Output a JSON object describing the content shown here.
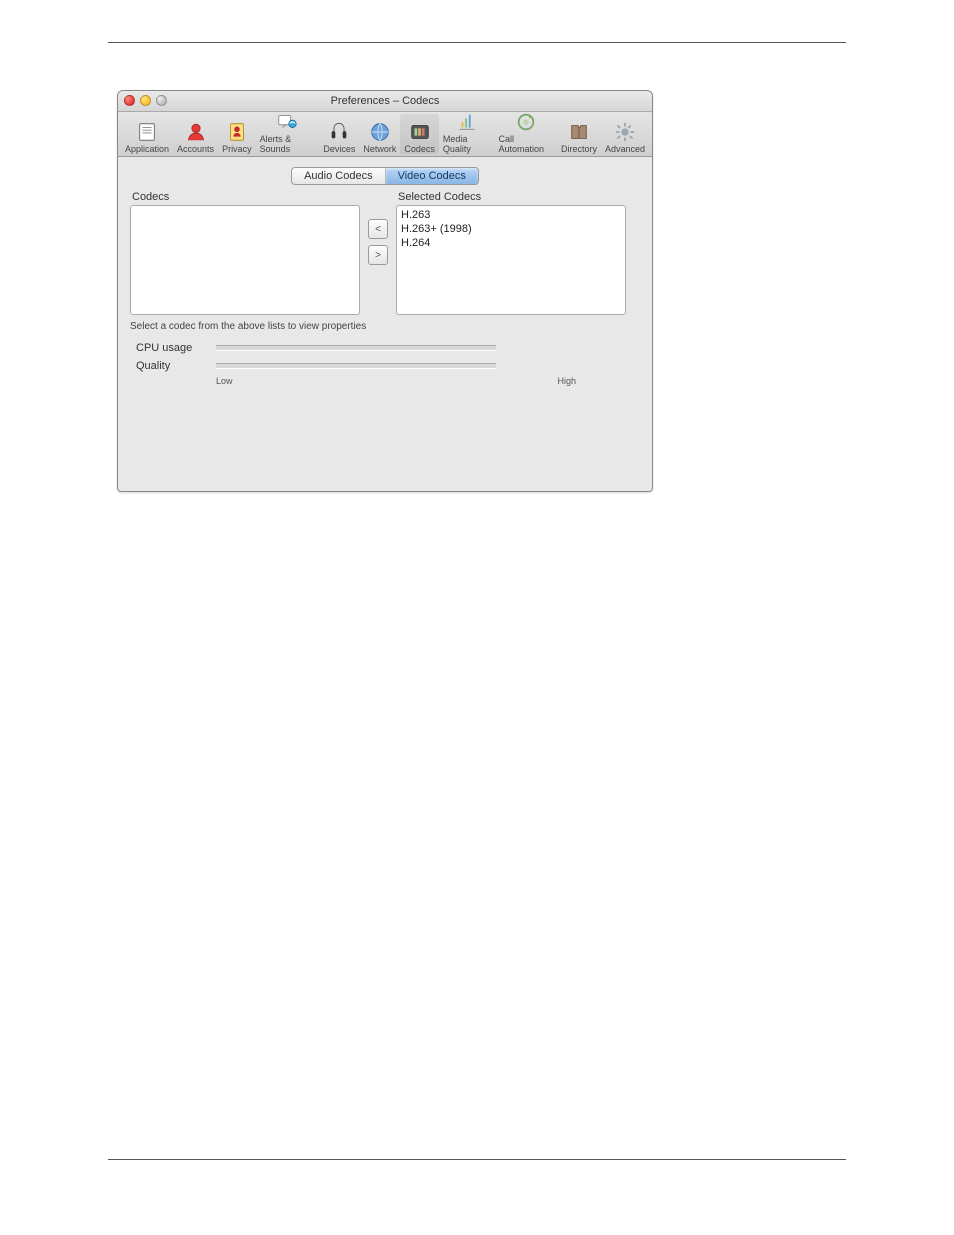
{
  "window": {
    "title": "Preferences – Codecs"
  },
  "toolbar": [
    {
      "label": "Application"
    },
    {
      "label": "Accounts"
    },
    {
      "label": "Privacy"
    },
    {
      "label": "Alerts & Sounds"
    },
    {
      "label": "Devices"
    },
    {
      "label": "Network"
    },
    {
      "label": "Codecs"
    },
    {
      "label": "Media Quality"
    },
    {
      "label": "Call Automation"
    },
    {
      "label": "Directory"
    },
    {
      "label": "Advanced"
    }
  ],
  "tabs": [
    "Audio Codecs",
    "Video Codecs"
  ],
  "lists": {
    "available_label": "Codecs",
    "selected_label": "Selected Codecs",
    "available": [],
    "selected": [
      "H.263",
      "H.263+ (1998)",
      "H.264"
    ]
  },
  "hint": "Select a codec from the above lists to view properties",
  "sliders": {
    "cpu_label": "CPU usage",
    "quality_label": "Quality",
    "low": "Low",
    "high": "High"
  }
}
